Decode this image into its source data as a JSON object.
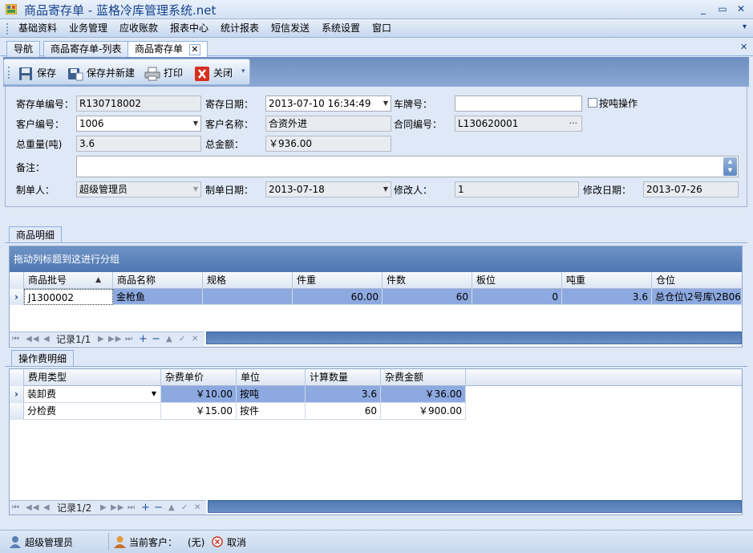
{
  "window": {
    "title": "商品寄存单 - 蓝格冷库管理系统.net",
    "minimize_glyph": "_",
    "restore_glyph": "▭",
    "close_glyph": "✕"
  },
  "menu": {
    "items": [
      "基础资料",
      "业务管理",
      "应收账款",
      "报表中心",
      "统计报表",
      "短信发送",
      "系统设置",
      "窗口"
    ],
    "overflow_glyph": "▾"
  },
  "doc_tabs": {
    "items": [
      {
        "label": "导航"
      },
      {
        "label": "商品寄存单-列表"
      },
      {
        "label": "商品寄存单",
        "active": true
      }
    ],
    "tab_close_glyph": "✕",
    "panel_close_glyph": "✕"
  },
  "toolbar": {
    "save_label": "保存",
    "save_new_label": "保存并新建",
    "print_label": "打印",
    "close_label": "关闭",
    "overflow_glyph": "▾"
  },
  "form": {
    "deposit_no_label": "寄存单编号：",
    "deposit_no": "R130718002",
    "deposit_date_label": "寄存日期：",
    "deposit_date": "2013-07-10  16:34:49",
    "plate_label": "车牌号：",
    "plate": "",
    "by_ton_label": "按吨操作",
    "by_ton_checked": false,
    "customer_no_label": "客户编号：",
    "customer_no": "1006",
    "customer_name_label": "客户名称：",
    "customer_name": "合资外进",
    "contract_no_label": "合同编号：",
    "contract_no": "L130620001",
    "contract_btn": "···",
    "total_weight_label": "总重量(吨)",
    "total_weight": "3.6",
    "total_amount_label": "总金额：",
    "total_amount": "￥936.00",
    "remark_label": "备注：",
    "remark": "",
    "creator_label": "制单人：",
    "creator": "超级管理员",
    "create_date_label": "制单日期：",
    "create_date": "2013-07-18",
    "modifier_label": "修改人：",
    "modifier": "1",
    "modify_date_label": "修改日期：",
    "modify_date": "2013-07-26"
  },
  "goods_section": {
    "tab_label": "商品明细",
    "group_hint": "拖动列标题到这进行分组",
    "columns": [
      "商品批号",
      "商品名称",
      "规格",
      "件重",
      "件数",
      "板位",
      "吨重",
      "仓位"
    ],
    "sort_glyph": "▲",
    "rows": [
      [
        "J1300002",
        "金枪鱼",
        "",
        "60.00",
        "60",
        "0",
        "3.6",
        "总仓位\\2号库\\2B06"
      ]
    ],
    "record_text": "记录1/1"
  },
  "fee_section": {
    "tab_label": "操作费明细",
    "columns": [
      "费用类型",
      "杂费单价",
      "单位",
      "计算数量",
      "杂费金额"
    ],
    "rows": [
      [
        "装卸费",
        "￥10.00",
        "按吨",
        "3.6",
        "￥36.00"
      ],
      [
        "分检费",
        "￥15.00",
        "按件",
        "60",
        "￥900.00"
      ]
    ],
    "record_text": "记录1/2"
  },
  "nav": {
    "first": "⏮",
    "prev_page": "◀◀",
    "prev": "◀",
    "next": "▶",
    "next_page": "▶▶",
    "last": "⏭",
    "add": "+",
    "remove": "−",
    "up": "▲",
    "confirm": "✓",
    "cancel": "✕"
  },
  "statusbar": {
    "user": "超级管理员",
    "current_customer_label": "当前客户：",
    "current_customer": "(无)",
    "cancel_label": "取消"
  },
  "colors": {
    "accent": "#4f78b2",
    "selection": "#8da9e0",
    "background": "#dfe8f6"
  }
}
